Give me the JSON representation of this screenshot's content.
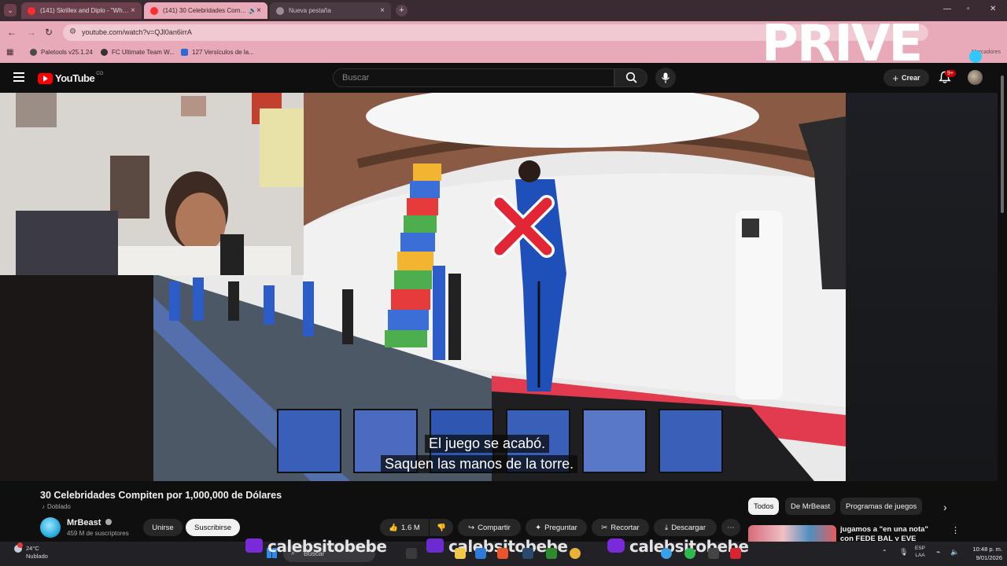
{
  "browser": {
    "tabs": [
      {
        "title": "(141) Skrillex and Diplo - \"Wh…",
        "state": "inactive"
      },
      {
        "title": "(141) 30 Celebridades Com…",
        "state": "active"
      },
      {
        "title": "Nueva pestaña",
        "state": "newtab"
      }
    ],
    "url": "youtube.com/watch?v=QJl0an6irrA",
    "bookmarks": [
      "Paletools v25.1.24",
      "FC Ultimate Team W...",
      "127 Versículos de la..."
    ],
    "bookmarks_right": "Marcadores"
  },
  "watermark": {
    "text": "PRIVE",
    "accent": "#2fc9ff"
  },
  "youtube": {
    "logo_text": "YouTube",
    "logo_suffix": "CO",
    "search_placeholder": "Buscar",
    "create_label": "Crear",
    "notif_badge": "9+"
  },
  "video": {
    "subtitle_line1": "El juego se acabó.",
    "subtitle_line2": "Saquen las manos de la torre.",
    "title": "30 Celebridades Compiten por 1,000,000 de Dólares",
    "dubbed_label": "Doblado",
    "channel_name": "MrBeast",
    "channel_subs": "459 M de suscriptores",
    "join_label": "Unirse",
    "subscribe_label": "Suscribirse",
    "likes": "1.6 M",
    "share_label": "Compartir",
    "ask_label": "Preguntar",
    "clip_label": "Recortar",
    "download_label": "Descargar"
  },
  "chips": [
    "Todos",
    "De MrBeast",
    "Programas de juegos"
  ],
  "recommended": {
    "title": "jugamos a \"en una nota\" con FEDE BAL y EVE ROTTO (muy…"
  },
  "overlay_social": {
    "handle": "calebsitobebe"
  },
  "taskbar": {
    "weather_temp": "24°C",
    "weather_desc": "Nublado",
    "search_placeholder": "Buscar",
    "lang_1": "ESP",
    "lang_2": "LAA",
    "time": "10:48 p. m.",
    "date": "9/01/2026"
  },
  "colors": {
    "brand_red": "#ff0000",
    "browser_pink": "#e8aab8",
    "bg": "#0f0f0f"
  }
}
